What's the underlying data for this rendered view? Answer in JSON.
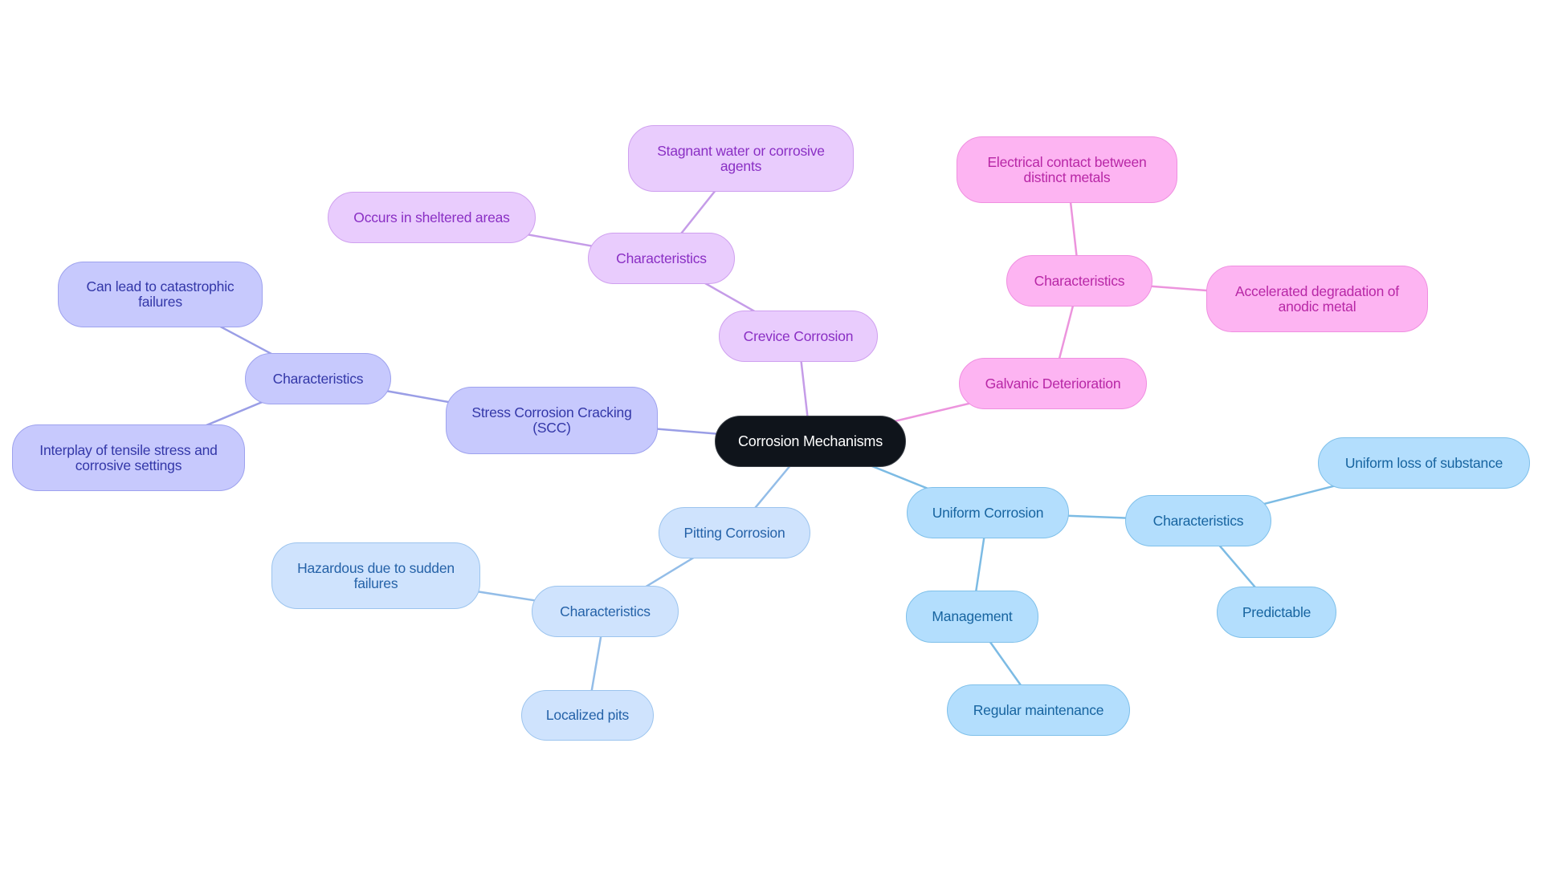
{
  "title": "Corrosion Mechanisms",
  "colors": {
    "purple_edge": "#c59ce8",
    "pink_edge": "#ec94dd",
    "indigo_edge": "#9a9ee6",
    "pale_edge": "#93bde8",
    "sky_edge": "#7cbbe4"
  },
  "nodes": [
    {
      "id": "root",
      "label": "Corrosion Mechanisms",
      "branch": "root"
    },
    {
      "id": "crevice",
      "label": "Crevice Corrosion",
      "parent": "root",
      "branch": "purple"
    },
    {
      "id": "crevice_char",
      "label": "Characteristics",
      "parent": "crevice",
      "branch": "purple"
    },
    {
      "id": "crevice_stagnant",
      "label": "Stagnant water or corrosive\nagents",
      "parent": "crevice_char",
      "branch": "purple"
    },
    {
      "id": "crevice_sheltered",
      "label": "Occurs in sheltered areas",
      "parent": "crevice_char",
      "branch": "purple"
    },
    {
      "id": "galvanic",
      "label": "Galvanic Deterioration",
      "parent": "root",
      "branch": "pink"
    },
    {
      "id": "galvanic_char",
      "label": "Characteristics",
      "parent": "galvanic",
      "branch": "pink"
    },
    {
      "id": "galvanic_contact",
      "label": "Electrical contact between\ndistinct metals",
      "parent": "galvanic_char",
      "branch": "pink"
    },
    {
      "id": "galvanic_anodic",
      "label": "Accelerated degradation of\nanodic metal",
      "parent": "galvanic_char",
      "branch": "pink"
    },
    {
      "id": "scc",
      "label": "Stress Corrosion Cracking\n(SCC)",
      "parent": "root",
      "branch": "indigo"
    },
    {
      "id": "scc_char",
      "label": "Characteristics",
      "parent": "scc",
      "branch": "indigo"
    },
    {
      "id": "scc_catastrophic",
      "label": "Can lead to catastrophic\nfailures",
      "parent": "scc_char",
      "branch": "indigo"
    },
    {
      "id": "scc_interplay",
      "label": "Interplay of tensile stress and\ncorrosive settings",
      "parent": "scc_char",
      "branch": "indigo"
    },
    {
      "id": "pitting",
      "label": "Pitting Corrosion",
      "parent": "root",
      "branch": "pale"
    },
    {
      "id": "pitting_char",
      "label": "Characteristics",
      "parent": "pitting",
      "branch": "pale"
    },
    {
      "id": "pitting_hazard",
      "label": "Hazardous due to sudden\nfailures",
      "parent": "pitting_char",
      "branch": "pale"
    },
    {
      "id": "pitting_localized",
      "label": "Localized pits",
      "parent": "pitting_char",
      "branch": "pale"
    },
    {
      "id": "uniform",
      "label": "Uniform Corrosion",
      "parent": "root",
      "branch": "sky"
    },
    {
      "id": "uniform_char",
      "label": "Characteristics",
      "parent": "uniform",
      "branch": "sky"
    },
    {
      "id": "uniform_loss",
      "label": "Uniform loss of substance",
      "parent": "uniform_char",
      "branch": "sky"
    },
    {
      "id": "uniform_predictable",
      "label": "Predictable",
      "parent": "uniform_char",
      "branch": "sky"
    },
    {
      "id": "uniform_mgmt",
      "label": "Management",
      "parent": "uniform",
      "branch": "sky"
    },
    {
      "id": "uniform_maint",
      "label": "Regular maintenance",
      "parent": "uniform_mgmt",
      "branch": "sky"
    }
  ]
}
